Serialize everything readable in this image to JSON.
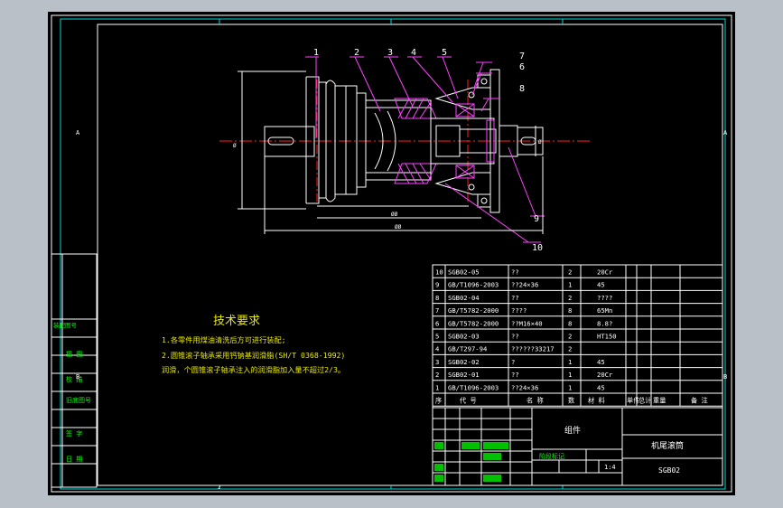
{
  "part_labels": [
    "1",
    "2",
    "3",
    "4",
    "5",
    "6",
    "7",
    "8",
    "9",
    "10"
  ],
  "dims": {
    "d1": "Ø",
    "d2": "Ø",
    "len1": "",
    "len2": "ØØ",
    "len3": "",
    "len4": "ØØ"
  },
  "tech": {
    "title": "技术要求",
    "line1": "1.各零件用煤油清洗后方可进行装配;",
    "line2": "2.圆锥滚子轴承采用钙钠基润滑脂(SH/T 0368-1992)",
    "line3": "润滑，个圆锥滚子轴承注入的润滑脂加入量不超过2/3。"
  },
  "bom": {
    "rows": [
      {
        "no": "10",
        "code": "SGB02-05",
        "name": "??",
        "qty": "2",
        "mat": "20Cr"
      },
      {
        "no": "9",
        "code": "GB/T1096-2003",
        "name": "??24×36",
        "qty": "1",
        "mat": "45"
      },
      {
        "no": "8",
        "code": "SGB02-04",
        "name": "??",
        "qty": "2",
        "mat": "????"
      },
      {
        "no": "7",
        "code": "GB/T5782-2000",
        "name": "????",
        "qty": "8",
        "mat": "65Mn"
      },
      {
        "no": "6",
        "code": "GB/T5782-2000",
        "name": "??M16×40",
        "qty": "8",
        "mat": "8.8?"
      },
      {
        "no": "5",
        "code": "SGB02-03",
        "name": "??",
        "qty": "2",
        "mat": "HT150"
      },
      {
        "no": "4",
        "code": "GB/T297-94",
        "name": "??????33217",
        "qty": "2",
        "mat": ""
      },
      {
        "no": "3",
        "code": "SGB02-02",
        "name": "?",
        "qty": "1",
        "mat": "45"
      },
      {
        "no": "2",
        "code": "SGB02-01",
        "name": "??",
        "qty": "1",
        "mat": "20Cr"
      },
      {
        "no": "1",
        "code": "GB/T1096-2003",
        "name": "??24×36",
        "qty": "1",
        "mat": "45"
      }
    ],
    "header": {
      "no": "序",
      "code": "代 号",
      "name": "名 称",
      "qty": "数",
      "mat": "材 料",
      "single": "单件",
      "total": "总计",
      "weight": "重量",
      "remark": "备 注"
    }
  },
  "title_block": {
    "group": "组件",
    "name": "机尾滚筒",
    "drawing_no": "SGB02",
    "scale": "1:4",
    "stage": "阶段标记",
    "sub1": "重量",
    "sub2": "比例"
  },
  "left_strip": {
    "items": [
      "装配图号",
      "描 图",
      "校 描",
      "旧底图号",
      "签 字",
      "日 期"
    ]
  },
  "edge_marks": {
    "right_a": "A",
    "right_b": "B",
    "left_a": "A",
    "left_b": "B",
    "bottom_mark": "2"
  }
}
